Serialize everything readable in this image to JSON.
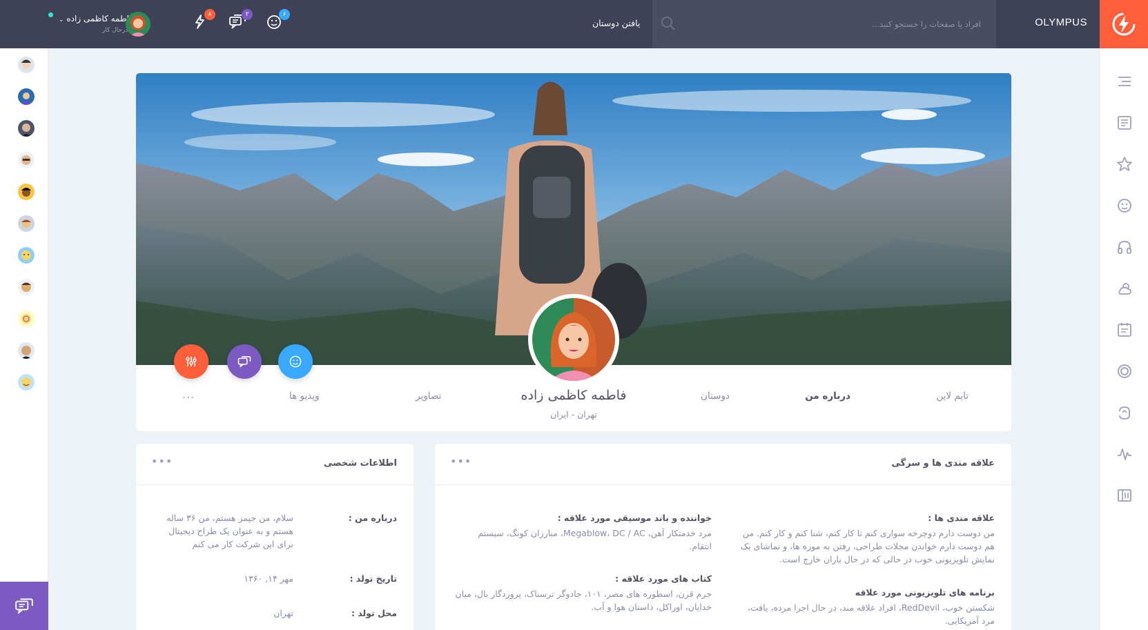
{
  "header": {
    "brand": "OLYMPUS",
    "search_placeholder": "افراد یا صفحات را جستجو کنید...",
    "find_friends": "یافتن دوستان",
    "badges": {
      "friends": "۶",
      "messages": "۲",
      "notifications": "۸"
    },
    "user": {
      "name": "فاطمه کاظمی زاده",
      "status": "درحال کار"
    },
    "colors": {
      "bar": "#3f4257",
      "accent": "#ff5e3a"
    }
  },
  "profile": {
    "name": "فاطمه کاظمی زاده",
    "location": "تهران - ایران",
    "tabs": [
      "تایم لاین",
      "درباره من",
      "دوستان",
      "تصاویر",
      "ویدیو ها"
    ],
    "active_tab": "درباره من",
    "more": "..."
  },
  "interests": {
    "title": "علاقه مندی ها و سرگی",
    "items": [
      {
        "title": "علاقه مندی ها :",
        "text": "من دوست دارم دوچرخه سواری کنم تا کار کنم، شنا کنم و کار کنم. من هم دوست دارم خواندن مجلات طراحی، رفتن به موزه ها، و تماشای یک نمایش تلویزیونی خوب در حالی که در حال باران خارج است."
      },
      {
        "title": "خواننده و باند موسیقی مورد علاقه :",
        "text": "مرد خدمتکار آهن، Megablow، DC / AC، مبارزان کونگ، سیستم انتقام."
      },
      {
        "title": "برنامه های تلویزیونی مورد علاقه",
        "text": "شکستن خوب، RedDevil، افراد علاقه مند، در حال اجرا مرده، یافت، مرد آمریکایی."
      },
      {
        "title": "کتاب های مورد علاقه :",
        "text": "جرم قرن، اسطوره های مصر، ۱۰۱، جادوگر ترسناک، پروردگار بال، میان خدایان، اوراکل، داستان هوا و آب."
      }
    ]
  },
  "personal": {
    "title": "اطلاعات شخصی",
    "rows": [
      {
        "label": "درباره من :",
        "value": "سلام، من جیمز هستم، من ۳۶ ساله هستم و به عنوان یک طراح دیجیتال برای این شرکت کار می کنم"
      },
      {
        "label": "تاریخ تولد :",
        "value": "مهر ۱۴, ۱۳۶۰"
      },
      {
        "label": "محل تولد :",
        "value": "تهران"
      }
    ]
  },
  "action_colors": [
    "#ff5e3a",
    "#7c5ac2",
    "#38a9ff"
  ]
}
